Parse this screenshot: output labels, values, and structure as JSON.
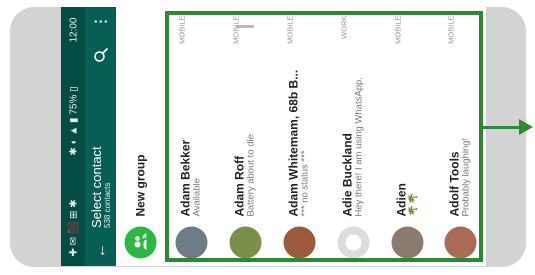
{
  "status_bar": {
    "time": "12:00",
    "battery": "75%"
  },
  "app_bar": {
    "title": "Select contact",
    "subtitle": "538 contacts",
    "back_icon": "arrow-back",
    "search_icon": "search",
    "more_icon": "more-vert"
  },
  "new_group": {
    "label": "New group",
    "icon": "group-add"
  },
  "contacts": [
    {
      "name": "Adam Bekker",
      "status": "Available",
      "type": "MOBILE",
      "avatar_color": "#6f7c86"
    },
    {
      "name": "Adam Roff",
      "status": "Battery about to die",
      "type": "MOBILE",
      "avatar_color": "#7a8f4a"
    },
    {
      "name": "Adam Whitemam, 68b B...",
      "status": "*** no status ***",
      "type": "MOBILE",
      "avatar_color": "#9c5a3c"
    },
    {
      "name": "Adie Buckland",
      "status": "Hey there! I am using WhatsApp.",
      "type": "WORK",
      "avatar_color": "#dcdcdc"
    },
    {
      "name": "Adien",
      "status": "🌴🌴",
      "type": "MOBILE",
      "avatar_color": "#8a7a70"
    },
    {
      "name": "Adolf Tools",
      "status": "Probably laughing!",
      "type": "MOBILE",
      "avatar_color": "#a86b58"
    }
  ],
  "colors": {
    "accent": "#2d8a34",
    "app_bar": "#075e54",
    "status_bar": "#054d44",
    "new_group_icon": "#2db742"
  }
}
